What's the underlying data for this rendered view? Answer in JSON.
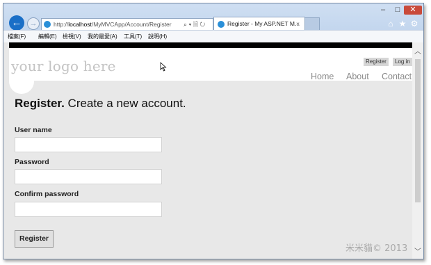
{
  "browser": {
    "url_prefix": "http://",
    "url_host": "localhost",
    "url_path": "/MyMVCApp/Account/Register",
    "address_tools": "⌕ ▾ 🗎 ↻",
    "tab_title": "Register - My ASP.NET M...",
    "tab_close": "×",
    "back": "←",
    "forward": "→",
    "min": "–",
    "max": "□",
    "close": "✕",
    "home": "⌂",
    "favorites": "★",
    "tools": "⚙",
    "menu": [
      "檔案(F)",
      "編輯(E)",
      "檢視(V)",
      "我的最愛(A)",
      "工具(T)",
      "說明(H)"
    ]
  },
  "site": {
    "logo": "your logo here",
    "register_link": "Register",
    "login_link": "Log in",
    "nav": [
      "Home",
      "About",
      "Contact"
    ]
  },
  "form": {
    "title_bold": "Register.",
    "title_rest": " Create a new account.",
    "fields": [
      {
        "label": "User name",
        "value": ""
      },
      {
        "label": "Password",
        "value": ""
      },
      {
        "label": "Confirm password",
        "value": ""
      }
    ],
    "submit": "Register"
  },
  "scrollbar": {
    "up": "︿",
    "down": "﹀"
  },
  "watermark": "米米貓© 2013"
}
